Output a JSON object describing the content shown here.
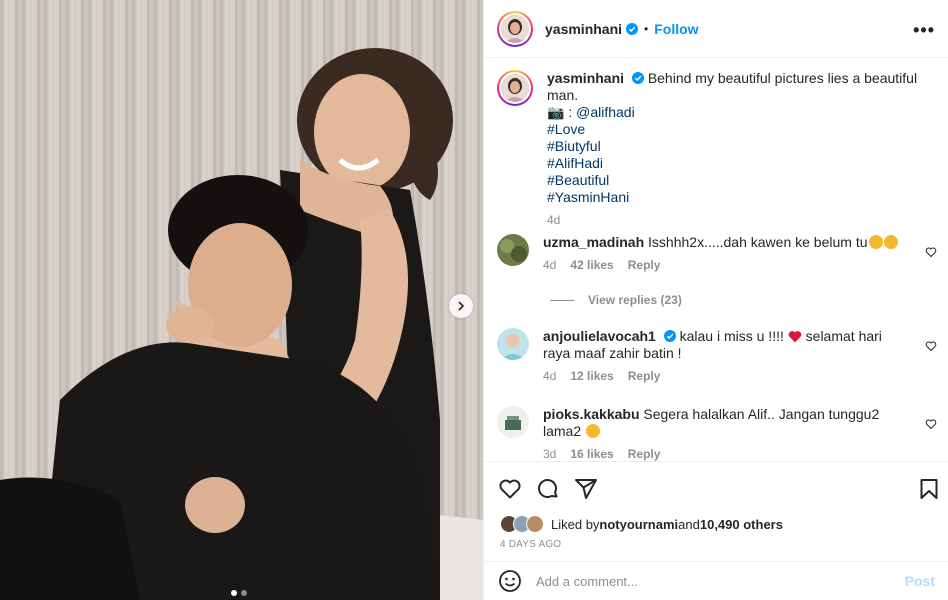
{
  "post": {
    "username": "yasminhani",
    "follow_label": "Follow",
    "separator": "•",
    "more_label": "•••"
  },
  "caption": {
    "username": "yasminhani",
    "text": "Behind my beautiful pictures lies a beautiful man.",
    "camera_emoji": "📷",
    "credit_prefix": " : ",
    "credit_mention": "@alifhadi",
    "hashtags": [
      "#Love",
      "#Biutyful",
      "#AlifHadi",
      "#Beautiful",
      "#YasminHani"
    ],
    "age": "4d"
  },
  "comments": [
    {
      "username": "uzma_madinah",
      "text": "Isshhh2x.....dah kawen ke belum tu",
      "age": "4d",
      "likes": "42 likes",
      "reply": "Reply",
      "view_replies": "View replies (23)"
    },
    {
      "username": "anjoulielavocah1",
      "text_a": "kalau i miss u !!!! ",
      "text_b": " selamat hari raya maaf zahir batin !",
      "age": "4d",
      "likes": "12 likes",
      "reply": "Reply"
    },
    {
      "username": "pioks.kakkabu",
      "text": "Segera halalkan Alif.. Jangan tunggu2 lama2 ",
      "age": "3d",
      "likes": "16 likes",
      "reply": "Reply"
    }
  ],
  "likes": {
    "prefix": "Liked by ",
    "user": "notyournami",
    "middle": " and ",
    "count": "10,490 others"
  },
  "date": "4 DAYS AGO",
  "add_comment": {
    "placeholder": "Add a comment...",
    "post_label": "Post"
  },
  "carousel": {
    "current": 1,
    "total": 2
  },
  "colors": {
    "accent": "#0095f6",
    "verified": "#0095f6",
    "text": "#262626",
    "muted": "#8e8e8e"
  }
}
